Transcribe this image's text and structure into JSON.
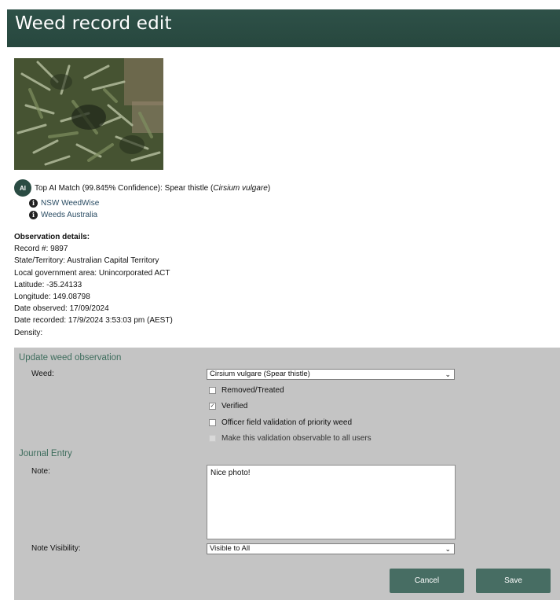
{
  "page": {
    "title": "Weed record edit"
  },
  "ai_match": {
    "badge": "AI",
    "prefix": "Top AI Match (99.845% Confidence): Spear thistle (",
    "scientific": "Cirsium vulgare",
    "suffix": ")"
  },
  "links": [
    {
      "icon": "info-icon",
      "label": "NSW WeedWise"
    },
    {
      "icon": "info-icon",
      "label": "Weeds Australia"
    }
  ],
  "observation": {
    "heading": "Observation details:",
    "lines": [
      "Record #: 9897",
      "State/Territory: Australian Capital Territory",
      "Local government area: Unincorporated ACT",
      "Latitude: -35.24133",
      "Longitude: 149.08798",
      "Date observed: 17/09/2024",
      "Date recorded: 17/9/2024 3:53:03 pm (AEST)",
      "Density:"
    ]
  },
  "form": {
    "section_title": "Update weed observation",
    "weed_label": "Weed:",
    "weed_value": "Cirsium vulgare (Spear thistle)",
    "checkboxes": [
      {
        "label": "Removed/Treated",
        "checked": false,
        "disabled": false
      },
      {
        "label": "Verified",
        "checked": true,
        "disabled": false
      },
      {
        "label": "Officer field validation of priority weed",
        "checked": false,
        "disabled": false
      },
      {
        "label": "Make this validation observable to all users",
        "checked": false,
        "disabled": true
      }
    ],
    "journal_title": "Journal Entry",
    "note_label": "Note:",
    "note_value": "Nice photo!",
    "visibility_label": "Note Visibility:",
    "visibility_value": "Visible to All",
    "cancel_label": "Cancel",
    "save_label": "Save"
  },
  "colors": {
    "header_bg": "#2a4c43",
    "panel_bg": "#c4c4c4",
    "button_bg": "#476d63",
    "section_title": "#3e6d5d"
  }
}
